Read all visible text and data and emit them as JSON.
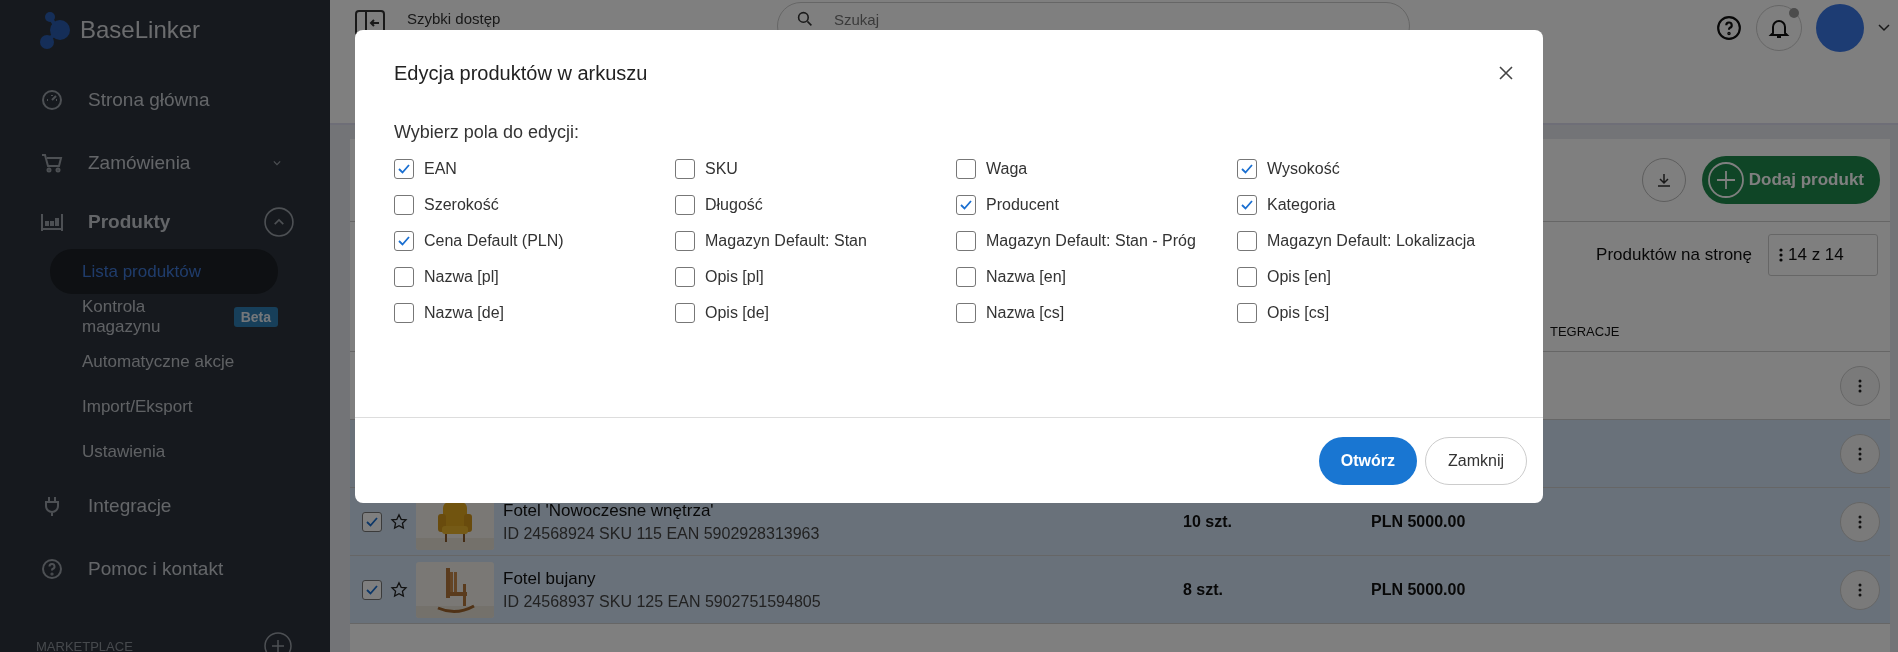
{
  "sidebar": {
    "logo": "BaseLinker",
    "items": [
      {
        "label": "Strona główna"
      },
      {
        "label": "Zamówienia",
        "expanded": false
      },
      {
        "label": "Produkty",
        "expanded": true,
        "children": [
          {
            "label": "Lista produktów",
            "selected": true
          },
          {
            "label": "Kontrola magazynu",
            "badge": "Beta",
            "selected": false
          },
          {
            "label": "Automatyczne akcje",
            "selected": false
          },
          {
            "label": "Import/Eksport",
            "selected": false
          },
          {
            "label": "Ustawienia",
            "selected": false
          }
        ]
      },
      {
        "label": "Integracje"
      },
      {
        "label": "Pomoc i kontakt"
      }
    ],
    "section": "MARKETPLACE"
  },
  "topbar": {
    "quick_access": "Szybki dostęp",
    "search": {
      "placeholder": "Szukaj"
    },
    "notifications_unread": true
  },
  "toolbar": {
    "add_button": "Dodaj produkt"
  },
  "pagination": {
    "label": "Produktów na stronę",
    "value": "14 z 14"
  },
  "table": {
    "columns": [
      "TEGRACJE"
    ],
    "rows": [
      {
        "selected": false
      },
      {
        "selected": true
      },
      {
        "selected": true,
        "name": "Fotel 'Nowoczesne wnętrza'",
        "details": "ID 24568924 SKU 115 EAN 5902928313963",
        "quantity": "10 szt.",
        "price": "PLN 5000.00"
      },
      {
        "selected": true,
        "name": "Fotel bujany",
        "details": "ID 24568937 SKU 125 EAN 5902751594805",
        "quantity": "8 szt.",
        "price": "PLN 5000.00"
      }
    ]
  },
  "dialog": {
    "title": "Edycja produktów w arkuszu",
    "section": "Wybierz pola do edycji:",
    "fields": [
      {
        "label": "EAN",
        "checked": true
      },
      {
        "label": "SKU",
        "checked": false
      },
      {
        "label": "Waga",
        "checked": false
      },
      {
        "label": "Wysokość",
        "checked": true
      },
      {
        "label": "Szerokość",
        "checked": false
      },
      {
        "label": "Długość",
        "checked": false
      },
      {
        "label": "Producent",
        "checked": true
      },
      {
        "label": "Kategoria",
        "checked": true
      },
      {
        "label": "Cena Default (PLN)",
        "checked": true
      },
      {
        "label": "Magazyn Default: Stan",
        "checked": false
      },
      {
        "label": "Magazyn Default: Stan - Próg",
        "checked": false
      },
      {
        "label": "Magazyn Default: Lokalizacja",
        "checked": false
      },
      {
        "label": "Nazwa [pl]",
        "checked": false
      },
      {
        "label": "Opis [pl]",
        "checked": false
      },
      {
        "label": "Nazwa [en]",
        "checked": false
      },
      {
        "label": "Opis [en]",
        "checked": false
      },
      {
        "label": "Nazwa [de]",
        "checked": false
      },
      {
        "label": "Opis [de]",
        "checked": false
      },
      {
        "label": "Nazwa [cs]",
        "checked": false
      },
      {
        "label": "Opis [cs]",
        "checked": false
      }
    ],
    "buttons": [
      {
        "label": "Otwórz",
        "kind": "primary"
      },
      {
        "label": "Zamknij",
        "kind": "secondary"
      }
    ]
  }
}
